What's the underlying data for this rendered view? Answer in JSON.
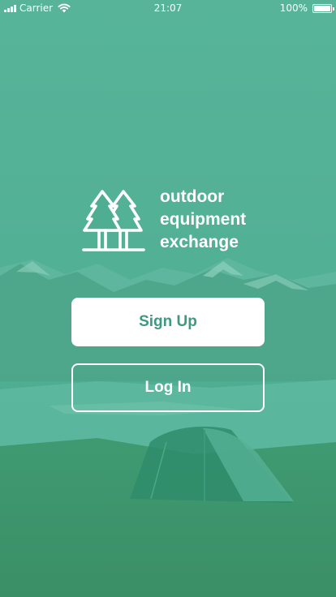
{
  "status_bar": {
    "carrier": "Carrier",
    "time": "21:07",
    "battery": "100%",
    "battery_level": 1.0
  },
  "brand": {
    "line1": "outdoor",
    "line2": "equipment",
    "line3": "exchange",
    "icon": "pine-trees-icon"
  },
  "actions": {
    "signup_label": "Sign Up",
    "login_label": "Log In"
  },
  "colors": {
    "overlay": "#4fae92",
    "accent_text": "#3d9a7f",
    "white": "#ffffff"
  }
}
